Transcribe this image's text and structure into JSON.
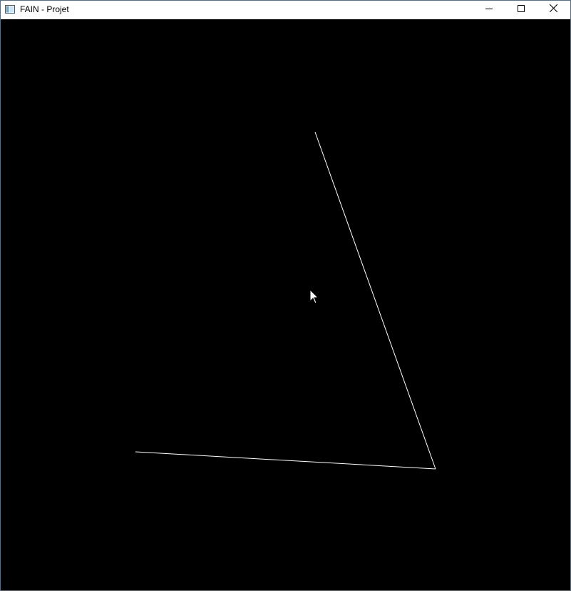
{
  "window": {
    "title": "FAIN - Projet",
    "icon": "app-window-icon",
    "controls": {
      "minimize_icon": "minimize-icon",
      "maximize_icon": "maximize-icon",
      "close_icon": "close-icon"
    }
  },
  "viewport": {
    "background_color": "#000000",
    "line_color": "#ffffff",
    "cursor_icon": "mouse-pointer-icon"
  }
}
